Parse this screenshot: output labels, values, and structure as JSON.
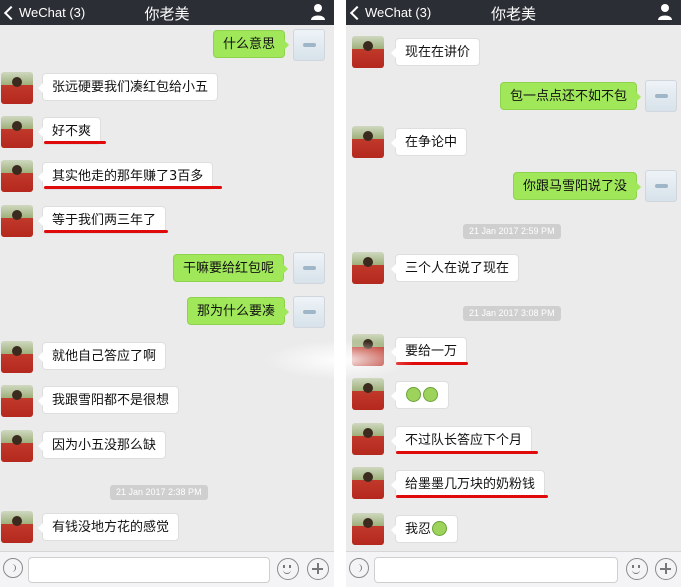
{
  "left": {
    "nav": {
      "back_label": "WeChat (3)",
      "title": "你老美"
    },
    "messages": [
      {
        "side": "out",
        "text": "什么意思"
      },
      {
        "side": "in",
        "text": "张远硬要我们凑红包给小五"
      },
      {
        "side": "in",
        "text": "好不爽",
        "underline": true
      },
      {
        "side": "in",
        "text": "其实他走的那年赚了3百多",
        "underline": true
      },
      {
        "side": "in",
        "text": "等于我们两三年了",
        "underline": true
      },
      {
        "side": "out",
        "text": "干嘛要给红包呢"
      },
      {
        "side": "out",
        "text": "那为什么要凑"
      },
      {
        "side": "in",
        "text": "就他自己答应了啊"
      },
      {
        "side": "in",
        "text": "我跟雪阳都不是很想"
      },
      {
        "side": "in",
        "text": "因为小五没那么缺"
      },
      {
        "side": "in",
        "text": "有钱没地方花的感觉"
      }
    ],
    "timestamps": [
      "21 Jan 2017 2:38 PM"
    ]
  },
  "right": {
    "nav": {
      "back_label": "WeChat (3)",
      "title": "你老美"
    },
    "messages": [
      {
        "side": "in",
        "text": "现在在讲价"
      },
      {
        "side": "out",
        "text": "包一点点还不如不包"
      },
      {
        "side": "in",
        "text": "在争论中"
      },
      {
        "side": "out",
        "text": "你跟马雪阳说了没"
      },
      {
        "side": "in",
        "text": "三个人在说了现在"
      },
      {
        "side": "in",
        "text": "要给一万",
        "underline": true
      },
      {
        "side": "in",
        "text": "",
        "emoji": 2
      },
      {
        "side": "in",
        "text": "不过队长答应下个月",
        "underline": true
      },
      {
        "side": "in",
        "text": "给墨墨几万块的奶粉钱",
        "underline": true
      },
      {
        "side": "in",
        "text": "我忍",
        "emoji": 1
      }
    ],
    "timestamps": [
      "21 Jan 2017 2:59 PM",
      "21 Jan 2017 3:08 PM"
    ]
  },
  "colors": {
    "navbar": "#2b2e34",
    "chat_bg": "#ebebeb",
    "sent_bubble": "#a0e75a",
    "received_bubble": "#ffffff",
    "underline": "#e00a0a"
  },
  "icons": [
    "chevron-left-icon",
    "user-icon",
    "voice-icon",
    "emoji-icon",
    "plus-icon"
  ]
}
